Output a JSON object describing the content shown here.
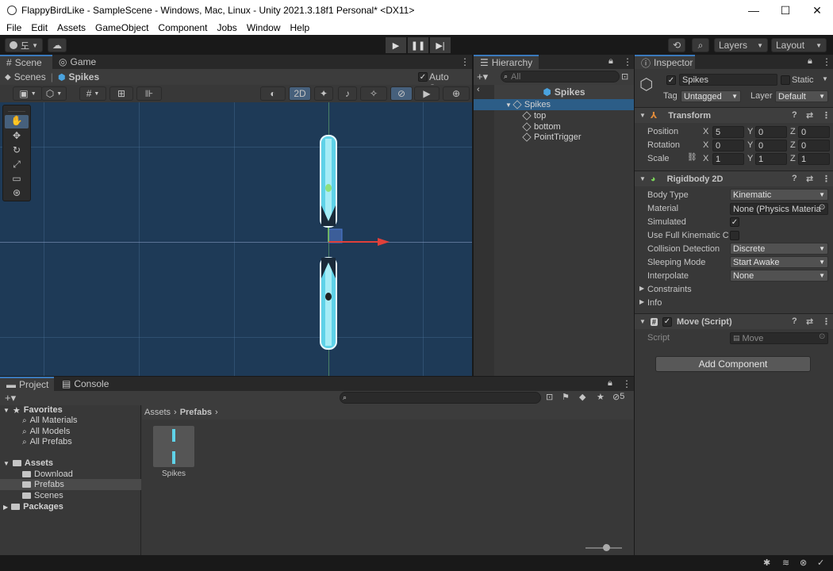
{
  "window": {
    "title": "FlappyBirdLike - SampleScene - Windows, Mac, Linux - Unity 2021.3.18f1 Personal* <DX11>",
    "minimize": "—",
    "maximize": "☐",
    "close": "✕"
  },
  "menu": [
    "File",
    "Edit",
    "Assets",
    "GameObject",
    "Component",
    "Jobs",
    "Window",
    "Help"
  ],
  "toolbar": {
    "account_label": "도",
    "layers_label": "Layers",
    "layout_label": "Layout",
    "play": "▶",
    "pause": "❚❚",
    "step": "▶|"
  },
  "scene_panel": {
    "tab_scene": "Scene",
    "tab_game": "Game",
    "breadcrumb_root": "Scenes",
    "breadcrumb_item": "Spikes",
    "auto_save_label": "Auto Save",
    "mode_2d": "2D"
  },
  "hierarchy": {
    "tab": "Hierarchy",
    "search_placeholder": "All",
    "prefab_root": "Spikes",
    "items": [
      {
        "label": "Spikes",
        "depth": 0,
        "selected": true
      },
      {
        "label": "top",
        "depth": 1
      },
      {
        "label": "bottom",
        "depth": 1
      },
      {
        "label": "PointTrigger",
        "depth": 1
      }
    ]
  },
  "inspector": {
    "tab": "Inspector",
    "object_name": "Spikes",
    "static_label": "Static",
    "tag_label": "Tag",
    "tag_value": "Untagged",
    "layer_label": "Layer",
    "layer_value": "Default",
    "transform": {
      "title": "Transform",
      "position_label": "Position",
      "rotation_label": "Rotation",
      "scale_label": "Scale",
      "position": {
        "x": "5",
        "y": "0",
        "z": "0"
      },
      "rotation": {
        "x": "0",
        "y": "0",
        "z": "0"
      },
      "scale": {
        "x": "1",
        "y": "1",
        "z": "1"
      }
    },
    "rigidbody": {
      "title": "Rigidbody 2D",
      "body_type_label": "Body Type",
      "body_type": "Kinematic",
      "material_label": "Material",
      "material": "None (Physics Materia",
      "simulated_label": "Simulated",
      "full_kinematic_label": "Use Full Kinematic Co",
      "collision_label": "Collision Detection",
      "collision": "Discrete",
      "sleeping_label": "Sleeping Mode",
      "sleeping": "Start Awake",
      "interpolate_label": "Interpolate",
      "interpolate": "None",
      "constraints_label": "Constraints",
      "info_label": "Info"
    },
    "move_script": {
      "title": "Move (Script)",
      "script_label": "Script",
      "script_value": "Move"
    },
    "add_component": "Add Component"
  },
  "project": {
    "tab_project": "Project",
    "tab_console": "Console",
    "favorites_label": "Favorites",
    "favorites": [
      "All Materials",
      "All Models",
      "All Prefabs"
    ],
    "assets_label": "Assets",
    "assets_children": [
      "Download",
      "Prefabs",
      "Scenes"
    ],
    "packages_label": "Packages",
    "breadcrumb": [
      "Assets",
      "Prefabs"
    ],
    "asset_item": "Spikes",
    "hidden_count": "5"
  },
  "colors": {
    "accent": "#3a79bb",
    "scene_bg": "#1e3a57",
    "selection": "#2c5d87"
  }
}
